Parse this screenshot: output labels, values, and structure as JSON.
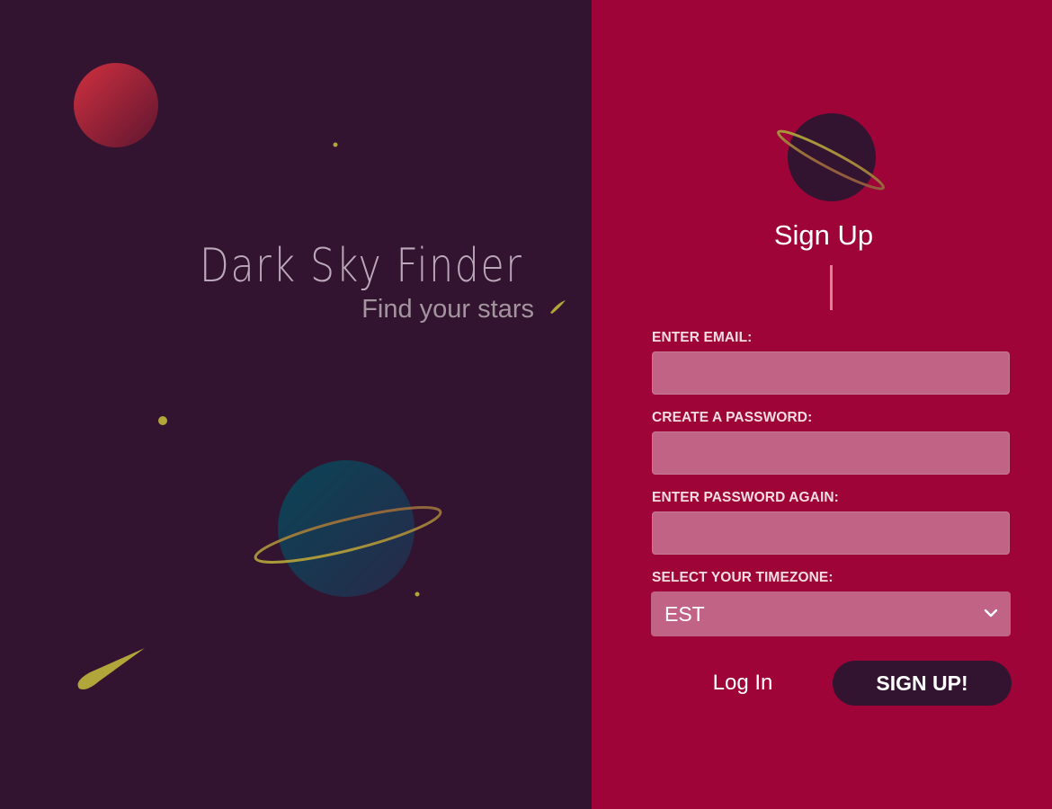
{
  "hero": {
    "app_title": "Dark Sky Finder",
    "tagline": "Find your stars"
  },
  "form": {
    "title": "Sign Up",
    "email_label": "ENTER EMAIL:",
    "email_value": "",
    "password_label": "CREATE A PASSWORD:",
    "password_value": "",
    "confirm_label": "ENTER PASSWORD AGAIN:",
    "confirm_value": "",
    "timezone_label": "SELECT YOUR TIMEZONE:",
    "timezone_value": "EST",
    "login_label": "Log In",
    "signup_label": "SIGN UP!"
  },
  "icons": {
    "logo": "ringed-planet-icon",
    "timezone_chevron": "chevron-down-icon"
  },
  "colors": {
    "left_panel_bg": "#331430",
    "right_panel_bg": "#9e0438",
    "input_bg": "#c16384",
    "comet_gold": "#b0a63a",
    "signup_button_bg": "#331430"
  }
}
